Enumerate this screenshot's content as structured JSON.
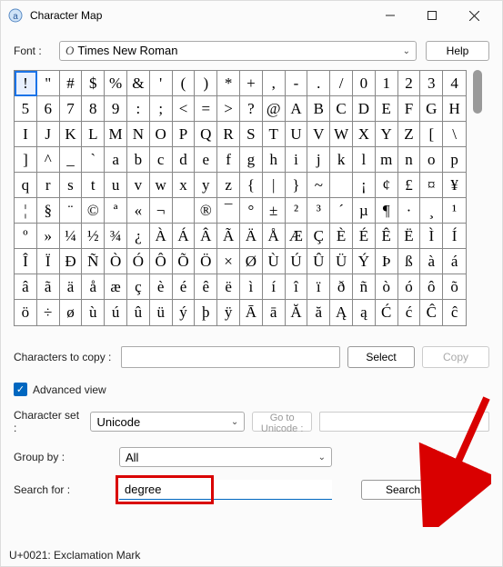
{
  "window": {
    "title": "Character Map"
  },
  "fontRow": {
    "label": "Font :",
    "fontIcon": "O",
    "fontName": "Times New Roman",
    "helpLabel": "Help"
  },
  "grid": {
    "selectedIndex": 0,
    "chars": [
      "!",
      "\"",
      "#",
      "$",
      "%",
      "&",
      "'",
      "(",
      ")",
      "*",
      "+",
      ",",
      "-",
      ".",
      "/",
      "0",
      "1",
      "2",
      "3",
      "4",
      "5",
      "6",
      "7",
      "8",
      "9",
      ":",
      ";",
      "<",
      "=",
      ">",
      "?",
      "@",
      "A",
      "B",
      "C",
      "D",
      "E",
      "F",
      "G",
      "H",
      "I",
      "J",
      "K",
      "L",
      "M",
      "N",
      "O",
      "P",
      "Q",
      "R",
      "S",
      "T",
      "U",
      "V",
      "W",
      "X",
      "Y",
      "Z",
      "[",
      "\\",
      "]",
      "^",
      "_",
      "`",
      "a",
      "b",
      "c",
      "d",
      "e",
      "f",
      "g",
      "h",
      "i",
      "j",
      "k",
      "l",
      "m",
      "n",
      "o",
      "p",
      "q",
      "r",
      "s",
      "t",
      "u",
      "v",
      "w",
      "x",
      "y",
      "z",
      "{",
      "|",
      "}",
      "~",
      " ",
      "¡",
      "¢",
      "£",
      "¤",
      "¥",
      "¦",
      "§",
      "¨",
      "©",
      "ª",
      "«",
      "¬",
      " ",
      "®",
      "¯",
      "°",
      "±",
      "²",
      "³",
      "´",
      "µ",
      "¶",
      "·",
      "¸",
      "¹",
      "º",
      "»",
      "¼",
      "½",
      "¾",
      "¿",
      "À",
      "Á",
      "Â",
      "Ã",
      "Ä",
      "Å",
      "Æ",
      "Ç",
      "È",
      "É",
      "Ê",
      "Ë",
      "Ì",
      "Í",
      "Î",
      "Ï",
      "Ð",
      "Ñ",
      "Ò",
      "Ó",
      "Ô",
      "Õ",
      "Ö",
      "×",
      "Ø",
      "Ù",
      "Ú",
      "Û",
      "Ü",
      "Ý",
      "Þ",
      "ß",
      "à",
      "á",
      "â",
      "ã",
      "ä",
      "å",
      "æ",
      "ç",
      "è",
      "é",
      "ê",
      "ë",
      "ì",
      "í",
      "î",
      "ï",
      "ð",
      "ñ",
      "ò",
      "ó",
      "ô",
      "õ",
      "ö",
      "÷",
      "ø",
      "ù",
      "ú",
      "û",
      "ü",
      "ý",
      "þ",
      "ÿ",
      "Ā",
      "ā",
      "Ă",
      "ă",
      "Ą",
      "ą",
      "Ć",
      "ć",
      "Ĉ",
      "ĉ"
    ]
  },
  "copyRow": {
    "label": "Characters to copy :",
    "value": "",
    "selectLabel": "Select",
    "copyLabel": "Copy"
  },
  "advancedView": {
    "checked": true,
    "label": "Advanced view"
  },
  "charSet": {
    "label": "Character set :",
    "value": "Unicode",
    "gotoLabel": "Go to Unicode :",
    "gotoValue": ""
  },
  "groupBy": {
    "label": "Group by :",
    "value": "All"
  },
  "search": {
    "label": "Search for :",
    "value": "degree",
    "buttonLabel": "Search"
  },
  "status": "U+0021: Exclamation Mark"
}
